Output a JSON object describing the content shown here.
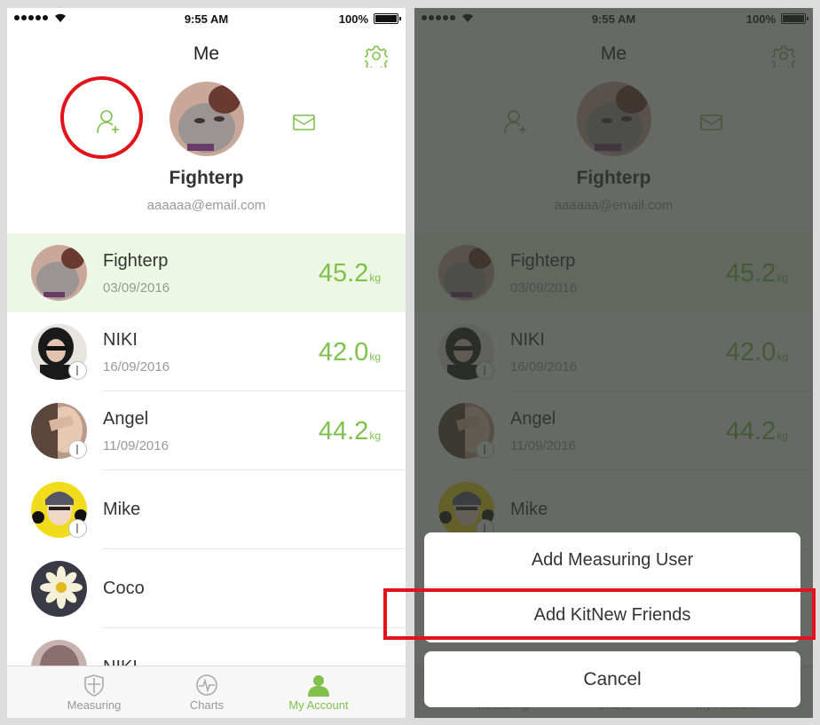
{
  "status": {
    "time": "9:55 AM",
    "battery": "100%"
  },
  "header": {
    "title": "Me"
  },
  "profile": {
    "name": "Fighterp",
    "email": "aaaaaa@email.com"
  },
  "users": [
    {
      "name": "Fighterp",
      "date": "03/09/2016",
      "weight": "45.2",
      "unit": "kg"
    },
    {
      "name": "NIKI",
      "date": "16/09/2016",
      "weight": "42.0",
      "unit": "kg"
    },
    {
      "name": "Angel",
      "date": "11/09/2016",
      "weight": "44.2",
      "unit": "kg"
    },
    {
      "name": "Mike"
    },
    {
      "name": "Coco"
    },
    {
      "name": "NIKI"
    }
  ],
  "tabs": [
    {
      "label": "Measuring",
      "icon": "shield-icon"
    },
    {
      "label": "Charts",
      "icon": "pulse-chart-icon"
    },
    {
      "label": "My Account",
      "icon": "person-icon",
      "active": true
    }
  ],
  "action_sheet": {
    "add_measuring_user": "Add Measuring User",
    "add_friends": "Add KitNew Friends",
    "cancel": "Cancel"
  },
  "colors": {
    "accent": "#7fc14a",
    "highlight": "#e3121b",
    "active_row": "#ecf7e4"
  }
}
